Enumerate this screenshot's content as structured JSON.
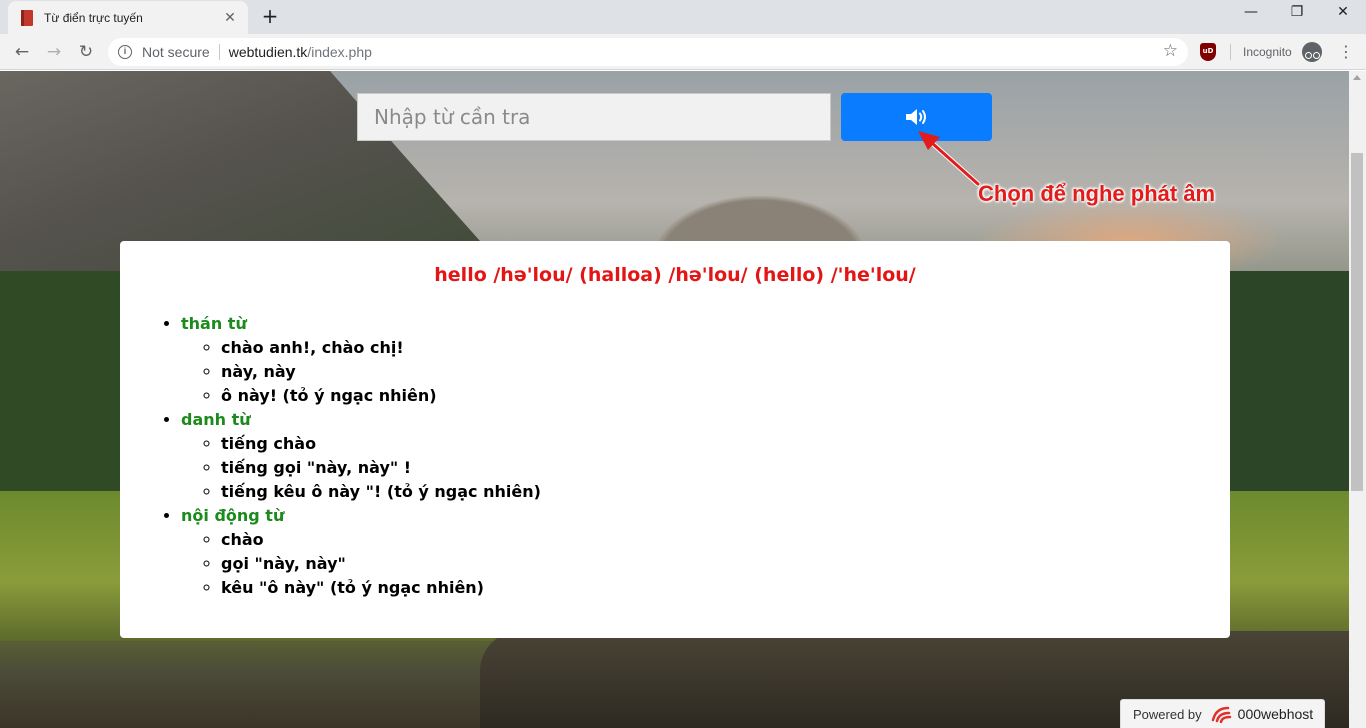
{
  "browser": {
    "tab_title": "Từ điển trực tuyến",
    "tab_close": "✕",
    "new_tab": "+",
    "window_controls": {
      "minimize": "—",
      "maximize": "❐",
      "close": "✕"
    },
    "nav": {
      "back": "←",
      "forward": "→",
      "reload": "↻"
    },
    "security_label": "Not secure",
    "url_host": "webtudien.tk",
    "url_path": "/index.php",
    "bookmark_star": "☆",
    "ublock_label": "uD",
    "incognito_label": "Incognito",
    "menu": "⋮"
  },
  "search": {
    "placeholder": "Nhập từ cần tra",
    "value": ""
  },
  "annotation": {
    "text": "Chọn để nghe phát âm",
    "color": "#e21b1b"
  },
  "entry": {
    "headword": "hello /hə'lou/ (halloa) /hə'lou/ (hello) /'he'lou/",
    "groups": [
      {
        "pos": "thán từ",
        "meanings": [
          "chào anh!, chào chị!",
          "này, này",
          "ô này! (tỏ ý ngạc nhiên)"
        ]
      },
      {
        "pos": "danh từ",
        "meanings": [
          "tiếng chào",
          "tiếng gọi \"này, này\" !",
          "tiếng kêu ô này \"! (tỏ ý ngạc nhiên)"
        ]
      },
      {
        "pos": "nội động từ",
        "meanings": [
          "chào",
          "gọi \"này, này\"",
          "kêu \"ô này\" (tỏ ý ngạc nhiên)"
        ]
      }
    ]
  },
  "footer": {
    "powered_by": "Powered by",
    "brand": "000webhost"
  },
  "colors": {
    "accent_button": "#0a7cff",
    "headword": "#e31515",
    "pos_label": "#1c8a1c"
  },
  "icons": [
    "favicon-book-icon",
    "info-icon",
    "star-icon",
    "ublock-icon",
    "incognito-icon",
    "menu-icon",
    "speaker-icon",
    "webhost-logo-icon"
  ]
}
